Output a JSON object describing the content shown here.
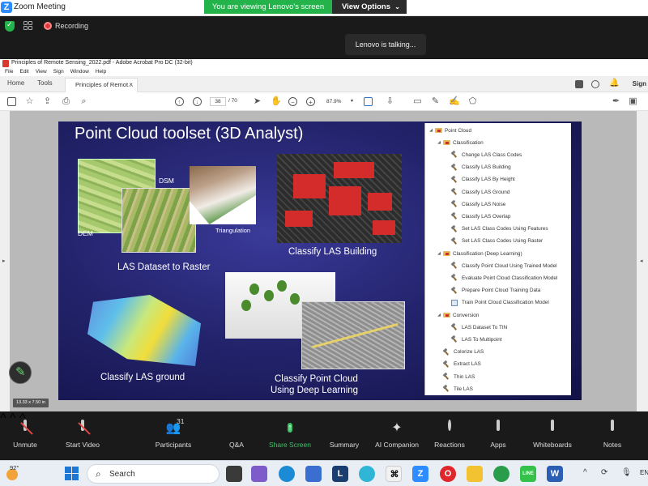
{
  "zoom": {
    "window_title": "Zoom Meeting",
    "viewing_banner": "You are viewing Lenovo's screen",
    "view_options": "View Options",
    "recording_label": "Recording",
    "talking_indicator": "Lenovo is talking..."
  },
  "acrobat": {
    "window_title": "Principles of Remote Sensing_2022.pdf - Adobe Acrobat Pro DC (32-bit)",
    "menu": [
      "File",
      "Edit",
      "View",
      "Sign",
      "Window",
      "Help"
    ],
    "tabs": {
      "home": "Home",
      "tools": "Tools",
      "document": "Principles of Remot..."
    },
    "sign_label": "Sign",
    "page_current": "38",
    "page_total": "/ 70",
    "zoom_level": "87.9%",
    "page_size": "13.33 x 7.50 in"
  },
  "slide": {
    "title": "Point Cloud toolset (3D Analyst)",
    "labels": {
      "dsm": "DSM",
      "dem": "DEM",
      "triangulation": "Triangulation",
      "las_to_raster": "LAS Dataset to Raster",
      "classify_building": "Classify LAS Building",
      "classify_ground": "Classify LAS ground",
      "classify_pc_line1": "Classify Point Cloud",
      "classify_pc_line2": "Using Deep Learning"
    },
    "tree": [
      {
        "label": "Point Cloud",
        "level": 0,
        "icon": "folder-icon",
        "expanded": true
      },
      {
        "label": "Classification",
        "level": 1,
        "icon": "folder-icon",
        "expanded": true
      },
      {
        "label": "Change LAS Class Codes",
        "level": 2,
        "icon": "hammer-icon"
      },
      {
        "label": "Classify LAS Building",
        "level": 2,
        "icon": "hammer-icon"
      },
      {
        "label": "Classify LAS By Height",
        "level": 2,
        "icon": "hammer-icon"
      },
      {
        "label": "Classify LAS Ground",
        "level": 2,
        "icon": "hammer-icon"
      },
      {
        "label": "Classify LAS Noise",
        "level": 2,
        "icon": "hammer-icon"
      },
      {
        "label": "Classify LAS Overlap",
        "level": 2,
        "icon": "hammer-icon"
      },
      {
        "label": "Set LAS Class Codes Using Features",
        "level": 2,
        "icon": "hammer-icon"
      },
      {
        "label": "Set LAS Class Codes Using Raster",
        "level": 2,
        "icon": "hammer-icon"
      },
      {
        "label": "Classification (Deep Learning)",
        "level": 1,
        "icon": "folder-icon",
        "expanded": true
      },
      {
        "label": "Classify Point Cloud Using Trained Model",
        "level": 2,
        "icon": "hammer-icon"
      },
      {
        "label": "Evaluate Point Cloud Classification Model",
        "level": 2,
        "icon": "hammer-icon"
      },
      {
        "label": "Prepare Point Cloud Training Data",
        "level": 2,
        "icon": "hammer-icon"
      },
      {
        "label": "Train Point Cloud Classification Model",
        "level": 2,
        "icon": "script-icon"
      },
      {
        "label": "Conversion",
        "level": 1,
        "icon": "folder-icon",
        "expanded": true
      },
      {
        "label": "LAS Dataset To TIN",
        "level": 2,
        "icon": "hammer-icon"
      },
      {
        "label": "LAS To Multipoint",
        "level": 2,
        "icon": "hammer-icon"
      },
      {
        "label": "Colorize LAS",
        "level": 1,
        "icon": "hammer-icon"
      },
      {
        "label": "Extract LAS",
        "level": 1,
        "icon": "hammer-icon"
      },
      {
        "label": "Thin LAS",
        "level": 1,
        "icon": "hammer-icon"
      },
      {
        "label": "Tile LAS",
        "level": 1,
        "icon": "hammer-icon"
      }
    ]
  },
  "controls": {
    "unmute": "Unmute",
    "start_video": "Start Video",
    "participants": "Participants",
    "participant_count": "31",
    "qa": "Q&A",
    "share_screen": "Share Screen",
    "summary": "Summary",
    "ai_companion": "AI Companion",
    "reactions": "Reactions",
    "apps": "Apps",
    "whiteboards": "Whiteboards",
    "notes": "Notes"
  },
  "taskbar": {
    "temperature": "92°",
    "search_placeholder": "Search",
    "language": "EN"
  },
  "colors": {
    "zoom_green": "#24b24b",
    "share_green": "#3ec267",
    "slide_bg": "#24246e",
    "building_red": "#d42b2b"
  }
}
